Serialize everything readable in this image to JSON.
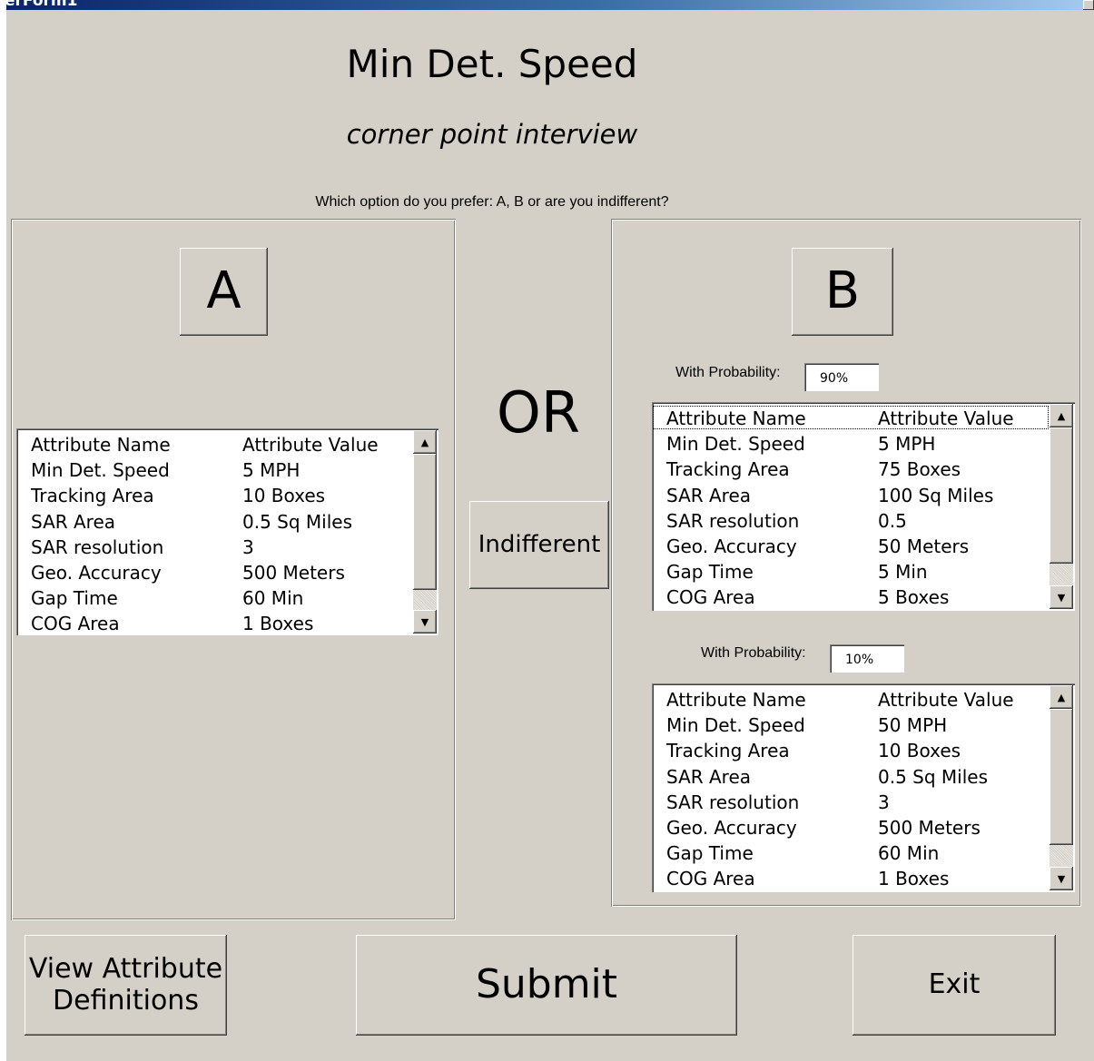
{
  "window": {
    "title": "erForm1"
  },
  "header": {
    "title": "Min Det. Speed",
    "subtitle": "corner point interview",
    "question": "Which option do you prefer: A, B or are you indifferent?"
  },
  "option_a": {
    "label": "A",
    "list": {
      "columns": [
        "Attribute Name",
        "Attribute Value"
      ],
      "rows": [
        [
          "Min Det. Speed",
          "5 MPH"
        ],
        [
          "Tracking Area",
          "10 Boxes"
        ],
        [
          "SAR Area",
          "0.5 Sq Miles"
        ],
        [
          "SAR resolution",
          "3"
        ],
        [
          "Geo. Accuracy",
          "500 Meters"
        ],
        [
          "Gap Time",
          "60 Min"
        ],
        [
          "COG Area",
          "1 Boxes"
        ]
      ]
    }
  },
  "middle": {
    "or_label": "OR",
    "indifferent_label": "Indifferent"
  },
  "option_b": {
    "label": "B",
    "branch1": {
      "probability_label": "With Probability:",
      "probability_value": "90%",
      "list": {
        "columns": [
          "Attribute Name",
          "Attribute Value"
        ],
        "rows": [
          [
            "Min Det. Speed",
            "5 MPH"
          ],
          [
            "Tracking Area",
            "75 Boxes"
          ],
          [
            "SAR Area",
            "100 Sq Miles"
          ],
          [
            "SAR resolution",
            "0.5"
          ],
          [
            "Geo. Accuracy",
            "50 Meters"
          ],
          [
            "Gap Time",
            "5 Min"
          ],
          [
            "COG Area",
            "5 Boxes"
          ]
        ]
      }
    },
    "branch2": {
      "probability_label": "With Probability:",
      "probability_value": "10%",
      "list": {
        "columns": [
          "Attribute Name",
          "Attribute Value"
        ],
        "rows": [
          [
            "Min Det. Speed",
            "50 MPH"
          ],
          [
            "Tracking Area",
            "10 Boxes"
          ],
          [
            "SAR Area",
            "0.5 Sq Miles"
          ],
          [
            "SAR resolution",
            "3"
          ],
          [
            "Geo. Accuracy",
            "500 Meters"
          ],
          [
            "Gap Time",
            "60 Min"
          ],
          [
            "COG Area",
            "1 Boxes"
          ]
        ]
      }
    }
  },
  "footer": {
    "view_definitions_line1": "View Attribute",
    "view_definitions_line2": "Definitions",
    "submit_label": "Submit",
    "exit_label": "Exit"
  },
  "icons": {
    "scroll_up": "scroll-up-arrow-icon",
    "scroll_down": "scroll-down-arrow-icon"
  }
}
